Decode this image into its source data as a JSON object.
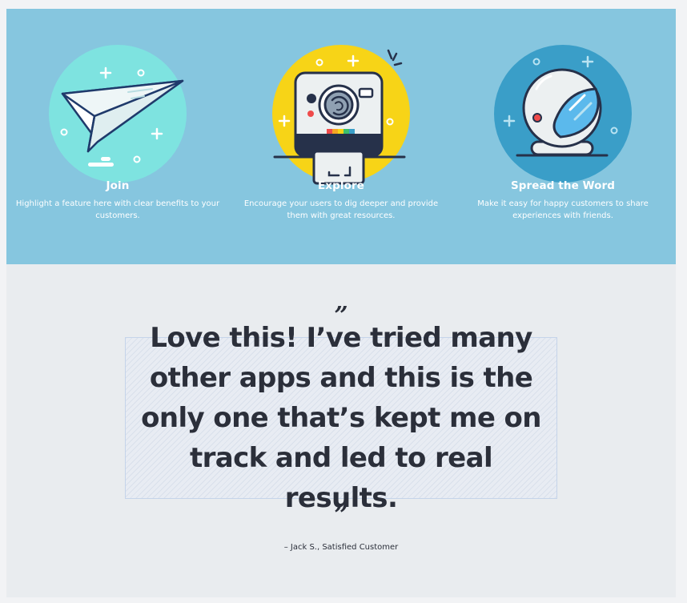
{
  "features": [
    {
      "title": "Join",
      "description": "Highlight a feature here with clear benefits to your customers.",
      "icon": "paper-plane-icon"
    },
    {
      "title": "Explore",
      "description": "Encourage your users to dig deeper and provide them with great resources.",
      "icon": "instant-camera-icon"
    },
    {
      "title": "Spread the Word",
      "description": "Make it easy for happy customers to share experiences with friends.",
      "icon": "astronaut-helmet-icon"
    }
  ],
  "testimonial": {
    "open_mark": "”",
    "close_mark": "”",
    "quote": "Love this! I’ve tried many other apps and this is the only one that’s kept me on track and led to real results.",
    "attribution": "– Jack S., Satisfied Customer"
  },
  "colors": {
    "features_background": "#86c6df",
    "join_circle": "#7ee3e0",
    "explore_circle": "#f7d417",
    "spread_circle": "#3a9ec8",
    "text_dark": "#2b2f3a"
  }
}
